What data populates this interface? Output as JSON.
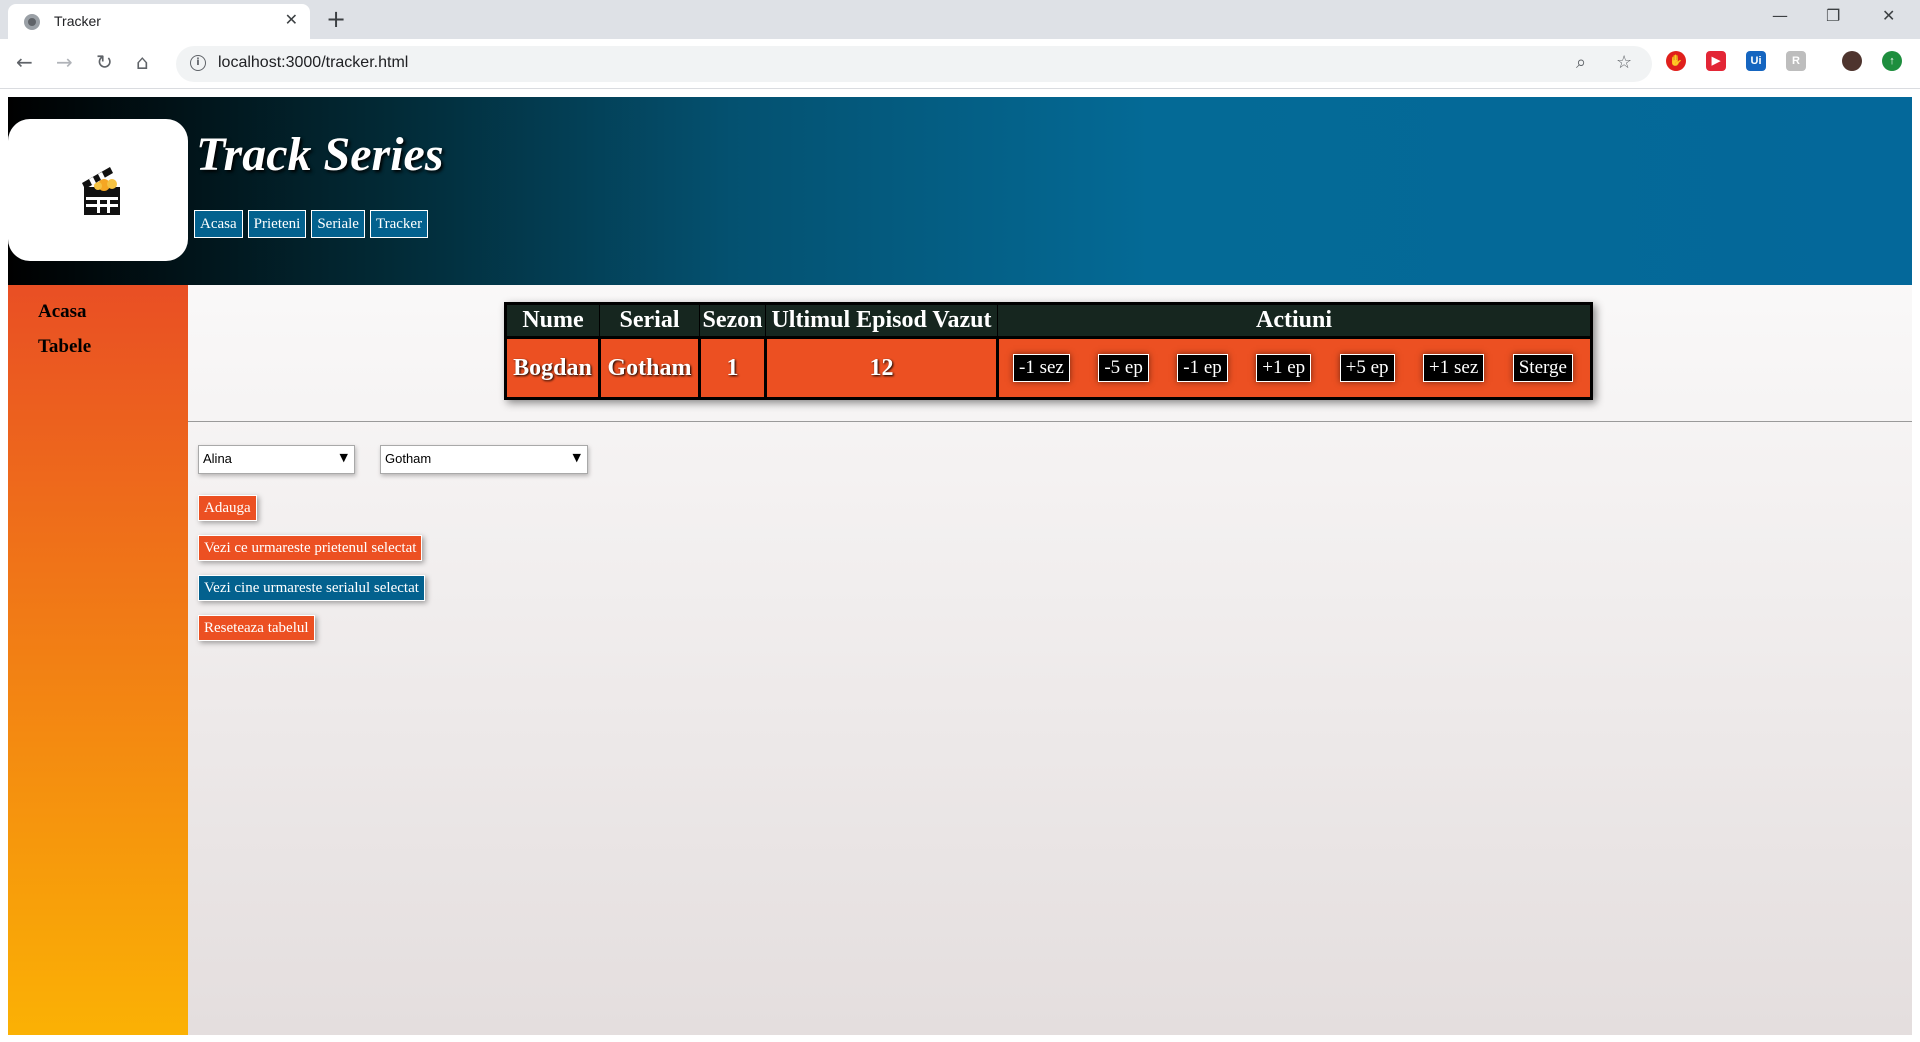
{
  "browser": {
    "tab_title": "Tracker",
    "url": "localhost:3000/tracker.html"
  },
  "header": {
    "title": "Track Series",
    "nav": [
      "Acasa",
      "Prieteni",
      "Seriale",
      "Tracker"
    ]
  },
  "sidebar": {
    "items": [
      "Acasa",
      "Tabele"
    ]
  },
  "table": {
    "headers": [
      "Nume",
      "Serial",
      "Sezon",
      "Ultimul Episod Vazut",
      "Actiuni"
    ],
    "row": {
      "name": "Bogdan",
      "series": "Gotham",
      "season": "1",
      "episode": "12"
    },
    "actions": [
      "-1 sez",
      "-5 ep",
      "-1 ep",
      "+1 ep",
      "+5 ep",
      "+1 sez",
      "Sterge"
    ]
  },
  "controls": {
    "friend_select": "Alina",
    "series_select": "Gotham",
    "buttons": [
      "Adauga",
      "Vezi ce urmareste prietenul selectat",
      "Vezi cine urmareste serialul selectat",
      "Reseteaza tabelul"
    ]
  }
}
